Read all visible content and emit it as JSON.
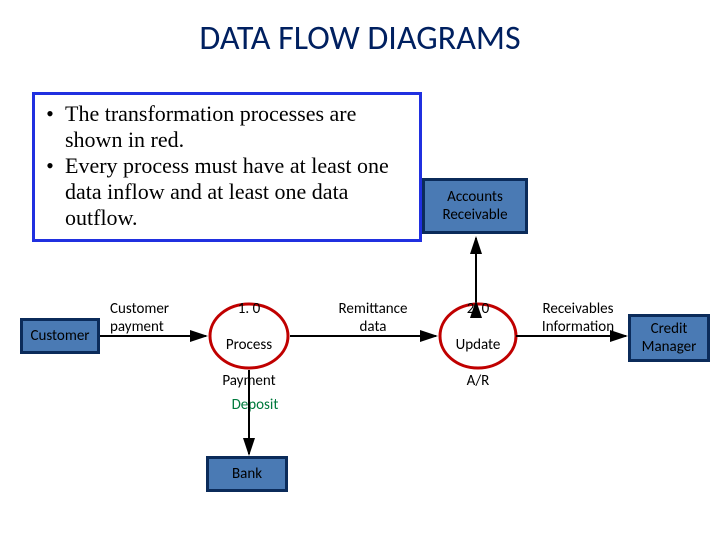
{
  "title": "DATA FLOW DIAGRAMS",
  "callout": {
    "bullet1": "The transformation processes are shown in red.",
    "bullet2": "Every process must have at least one data inflow and at least one data outflow."
  },
  "entities": {
    "customer": "Customer",
    "accounts_receivable": "Accounts\nReceivable",
    "bank": "Bank",
    "credit_manager": "Credit\nManager"
  },
  "processes": {
    "p1": {
      "num": "1. 0",
      "l2": "Process",
      "l3": "Payment"
    },
    "p2": {
      "num": "2. 0",
      "l2": "Update",
      "l3": "A/R"
    }
  },
  "flows": {
    "customer_payment": "Customer\npayment",
    "remittance_data": "Remittance\ndata",
    "deposit": "Deposit",
    "receivables_info": "Receivables\nInformation"
  },
  "colors": {
    "title": "#002060",
    "callout_border": "#2030e0",
    "entity_fill": "#4a7ab4",
    "entity_border": "#0b2b5a",
    "process_stroke": "#c00000",
    "arrow": "#000000",
    "deposit_label": "#007a3d"
  }
}
